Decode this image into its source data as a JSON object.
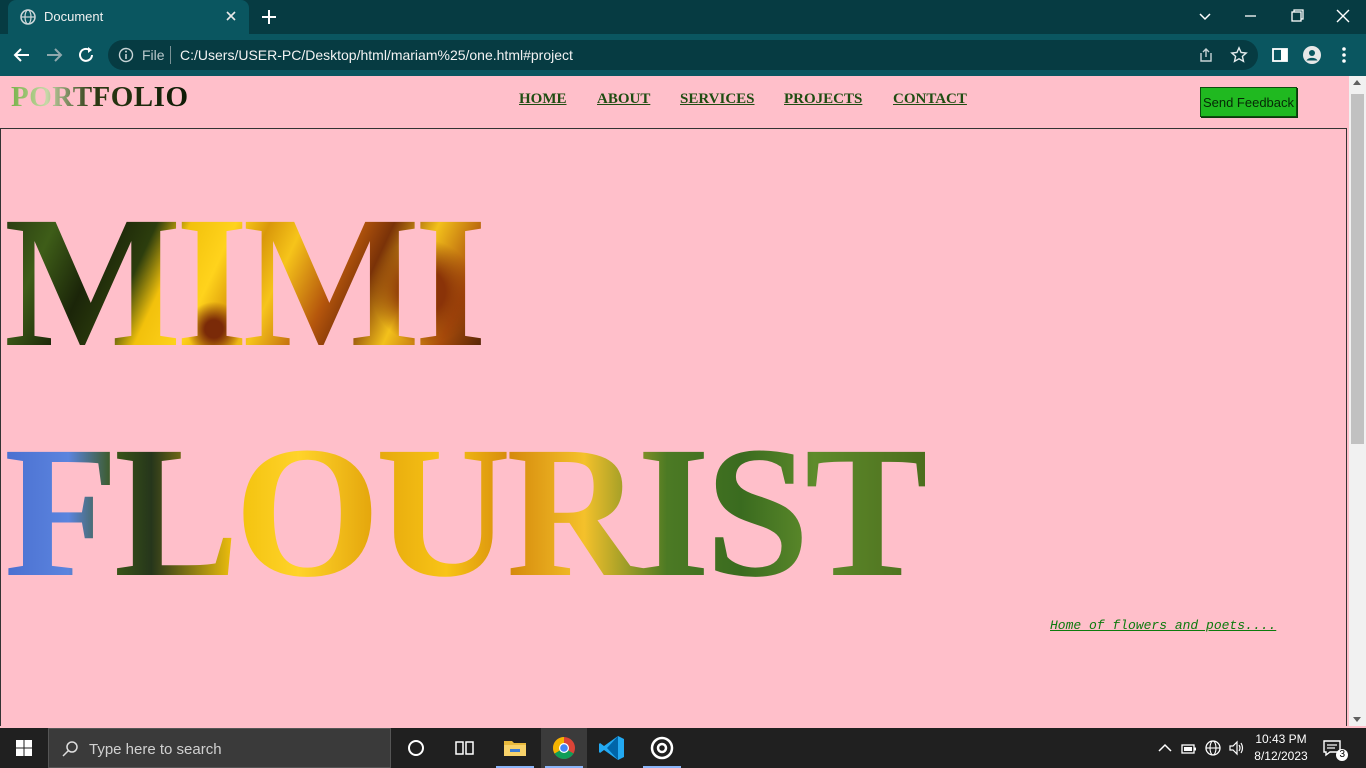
{
  "browser": {
    "tab_title": "Document",
    "omnibox_scheme": "File",
    "url": "C:/Users/USER-PC/Desktop/html/mariam%25/one.html#project"
  },
  "site": {
    "brand": "PORTFOLIO",
    "nav": [
      "HOME",
      "ABOUT",
      "SERVICES",
      "PROJECTS",
      "CONTACT"
    ],
    "feedback_button": "Send Feedback",
    "hero_line1": "MIMI",
    "hero_line2": "FLOURIST",
    "tagline": "Home of flowers and poets...."
  },
  "taskbar": {
    "search_placeholder": "Type here to search",
    "time": "10:43 PM",
    "date": "8/12/2023",
    "notification_count": "3"
  },
  "colors": {
    "page_background": "#ffbfca",
    "chrome_dark": "#063b42",
    "chrome_toolbar": "#0a5660",
    "feedback_button": "#20b920",
    "nav_link": "#1f4d12"
  }
}
